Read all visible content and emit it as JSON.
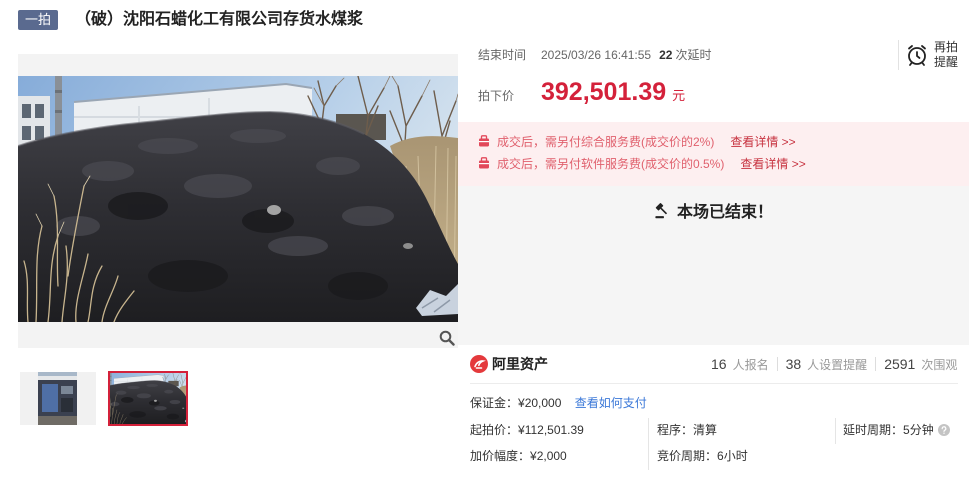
{
  "header": {
    "badge": "一拍",
    "title": "（破）沈阳石蜡化工有限公司存货水煤浆"
  },
  "timing": {
    "end_label": "结束时间",
    "end_time": "2025/03/26 16:41:55",
    "delay_count": "22",
    "delay_label": "次延时"
  },
  "reminder": {
    "line1": "再拍",
    "line2": "提醒"
  },
  "price": {
    "label": "拍下价",
    "value": "392,501.39",
    "unit": "元"
  },
  "fees": [
    {
      "text": "成交后，需另付综合服务费(成交价的2%)",
      "link": "查看详情 >>"
    },
    {
      "text": "成交后，需另付软件服务费(成交价的0.5%)",
      "link": "查看详情 >>"
    }
  ],
  "status": {
    "text": "本场已结束！"
  },
  "stats": {
    "brand": "阿里资产",
    "items": [
      {
        "count": "16",
        "label": "人报名"
      },
      {
        "count": "38",
        "label": "人设置提醒"
      },
      {
        "count": "2591",
        "label": "次围观"
      }
    ]
  },
  "details": {
    "deposit": {
      "label": "保证金：",
      "value": "¥20,000",
      "link": "查看如何支付"
    },
    "start_price": {
      "label": "起拍价：",
      "value": "¥112,501.39"
    },
    "procedure": {
      "label": "程序：",
      "value": "清算"
    },
    "delay_period": {
      "label": "延时周期：",
      "value": "5分钟"
    },
    "increment": {
      "label": "加价幅度：",
      "value": "¥2,000"
    },
    "bidding_period": {
      "label": "竞价周期：",
      "value": "6小时"
    }
  },
  "icons": {
    "reminder": "alarm-clock-icon",
    "fee_notice": "gift-icon",
    "status": "gavel-icon",
    "zoom": "magnifier-icon",
    "help": "question-icon",
    "brand_logo": "ali-assets-logo-icon"
  },
  "colors": {
    "accent": "#d4213a",
    "badge_bg": "#5a6a8f",
    "link": "#3b78d8",
    "fee_text": "#e0606d",
    "fee_bg": "#fdeff0",
    "ended_bg": "#f5f5f5"
  }
}
